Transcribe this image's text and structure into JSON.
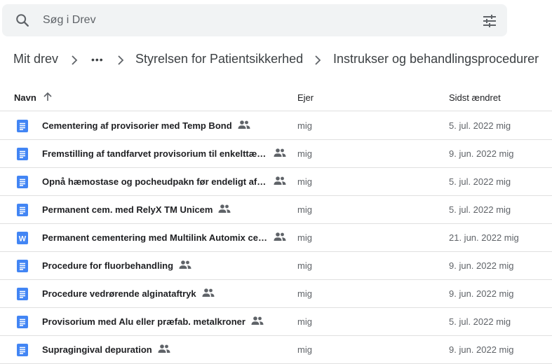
{
  "search": {
    "placeholder": "Søg i Drev",
    "value": ""
  },
  "breadcrumb": {
    "root": "Mit drev",
    "ellipsis": "•••",
    "level1": "Styrelsen for Patientsikkerhed",
    "level2": "Instrukser og behandlingsprocedurer"
  },
  "columns": {
    "name": "Navn",
    "owner": "Ejer",
    "modified": "Sidst ændret"
  },
  "colors": {
    "doc": "#4285f4",
    "text": "#3c4043",
    "muted": "#5f6368",
    "divider": "#e0e0e0"
  },
  "files": [
    {
      "name": "Cementering af provisorier med Temp Bond",
      "type": "doc",
      "shared": true,
      "owner": "mig",
      "modified": "5. jul. 2022 mig"
    },
    {
      "name": "Fremstilling af tandfarvet provisorium til enkelttænder",
      "type": "doc",
      "shared": true,
      "owner": "mig",
      "modified": "9. jun. 2022 mig"
    },
    {
      "name": "Opnå hæmostase og pocheudpakn før endeligt aftryk",
      "type": "doc",
      "shared": true,
      "owner": "mig",
      "modified": "5. jul. 2022 mig"
    },
    {
      "name": "Permanent cem. med RelyX TM Unicem",
      "type": "doc",
      "shared": true,
      "owner": "mig",
      "modified": "5. jul. 2022 mig"
    },
    {
      "name": "Permanent cementering med Multilink Automix ceme…",
      "type": "word",
      "shared": true,
      "owner": "mig",
      "modified": "21. jun. 2022 mig"
    },
    {
      "name": "Procedure for fluorbehandling",
      "type": "doc",
      "shared": true,
      "owner": "mig",
      "modified": "9. jun. 2022 mig"
    },
    {
      "name": "Procedure vedrørende alginataftryk",
      "type": "doc",
      "shared": true,
      "owner": "mig",
      "modified": "9. jun. 2022 mig"
    },
    {
      "name": "Provisorium med Alu eller præfab. metalkroner",
      "type": "doc",
      "shared": true,
      "owner": "mig",
      "modified": "5. jul. 2022 mig"
    },
    {
      "name": "Supragingival depuration",
      "type": "doc",
      "shared": true,
      "owner": "mig",
      "modified": "9. jun. 2022 mig"
    }
  ]
}
